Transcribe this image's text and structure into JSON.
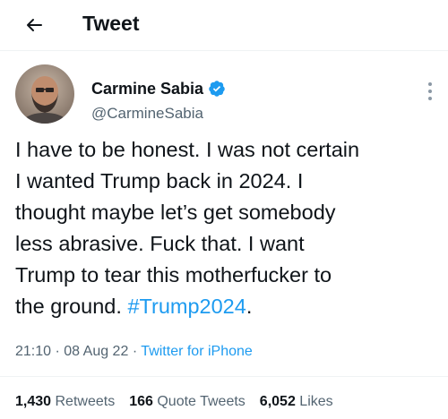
{
  "header": {
    "back_icon": "arrow-left-icon",
    "title": "Tweet"
  },
  "tweet": {
    "author": {
      "name": "Carmine Sabia",
      "handle": "@CarmineSabia",
      "verified": true,
      "verified_icon": "verified-badge-icon"
    },
    "more_icon": "more-vertical-icon",
    "text": "I have to be honest. I was not certain\nI wanted Trump back in 2024. I\nthought maybe let’s get somebody\nless abrasive. Fuck that. I want\nTrump to tear this motherfucker to\nthe ground. ",
    "hashtag": "#Trump2024",
    "text_end": ".",
    "time": "21:10",
    "date": "08 Aug 22",
    "separator": "·",
    "source": "Twitter for iPhone",
    "stats": {
      "retweets_count": "1,430",
      "retweets_label": "Retweets",
      "quote_tweets_count": "166",
      "quote_tweets_label": "Quote Tweets",
      "likes_count": "6,052",
      "likes_label": "Likes"
    }
  },
  "colors": {
    "accent": "#1d9bf0",
    "text_primary": "#0f1419",
    "text_secondary": "#536471",
    "divider": "#eff3f4"
  }
}
